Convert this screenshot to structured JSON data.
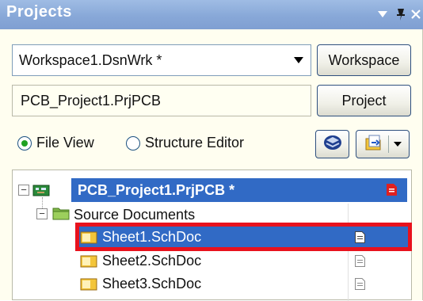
{
  "panel": {
    "title": "Projects",
    "icons": [
      "dropdown-triangle-icon",
      "pin-icon",
      "close-icon"
    ]
  },
  "workspace": {
    "selected": "Workspace1.DsnWrk *",
    "button_label": "Workspace"
  },
  "project": {
    "value": "PCB_Project1.PrjPCB",
    "button_label": "Project"
  },
  "view_mode": {
    "options": [
      {
        "label": "File View",
        "selected": true
      },
      {
        "label": "Structure Editor",
        "selected": false
      }
    ]
  },
  "tree": {
    "project_label": "PCB_Project1.PrjPCB *",
    "folder_label": "Source Documents",
    "documents": [
      {
        "label": "Sheet1.SchDoc",
        "selected": true
      },
      {
        "label": "Sheet2.SchDoc",
        "selected": false
      },
      {
        "label": "Sheet3.SchDoc",
        "selected": false
      }
    ]
  },
  "colors": {
    "selection": "#316ac5",
    "highlight_border": "#e8121d",
    "titlebar": "#88a8d8"
  }
}
